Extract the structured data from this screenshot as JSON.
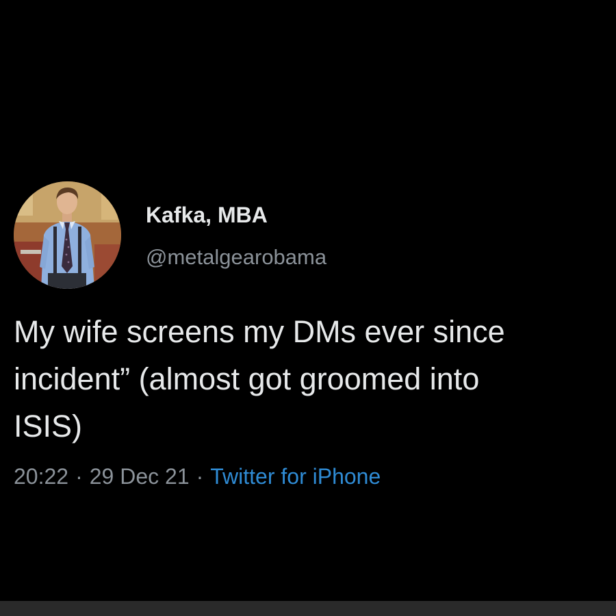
{
  "tweet": {
    "author": {
      "display_name": "Kafka, MBA",
      "handle": "@metalgearobama"
    },
    "text_lines": [
      "My wife screens my DMs ever since",
      "incident” (almost got groomed into",
      "ISIS)"
    ],
    "meta": {
      "time": "20:22",
      "separator": "·",
      "date": "29 Dec 21",
      "source": "Twitter for iPhone"
    }
  },
  "colors": {
    "background": "#000000",
    "primary_text": "#e7e9ea",
    "secondary_text": "#8b9299",
    "link": "#2f8bd4",
    "bottom_strip": "#2a2a2a"
  },
  "icons": {
    "avatar": "profile-photo-man-in-blue-shirt-and-suspenders"
  }
}
